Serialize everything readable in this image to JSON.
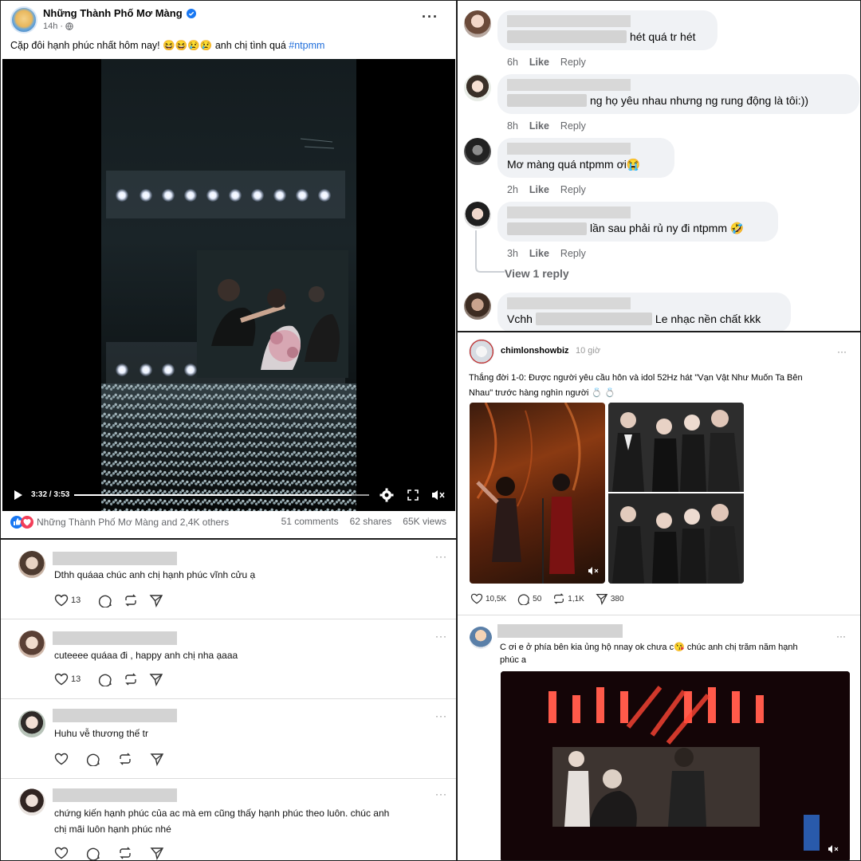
{
  "fb_post": {
    "page_name": "Những Thành Phố Mơ Màng",
    "time": "14h ·",
    "caption_text": "Cặp đôi hạnh phúc nhất hôm nay! 😆😆😢😢 anh chị tình quá ",
    "hashtag": "#ntpmm",
    "video_time": "3:32 / 3:53",
    "video_progress": 0.94,
    "reactions_text": "Những Thành Phố Mơ Màng and 2,4K others",
    "comments": "51 comments",
    "shares": "62 shares",
    "views": "65K views"
  },
  "fb_comments": [
    {
      "text": "hét quá tr hét",
      "time": "6h",
      "like": "Like",
      "reply": "Reply"
    },
    {
      "text": "ng họ yêu nhau nhưng ng rung động là tôi:))",
      "time": "8h",
      "like": "Like",
      "reply": "Reply"
    },
    {
      "text": "Mơ màng quá ntpmm ơi😭",
      "time": "2h",
      "like": "Like",
      "reply": "Reply"
    },
    {
      "text": "lần sau phải rủ ny đi ntpmm 🤣",
      "time": "3h",
      "like": "Like",
      "reply": "Reply"
    },
    {
      "text": "Vchh",
      "text2": "Le nhạc nền chất kkk"
    }
  ],
  "view_reply": "View 1 reply",
  "threads_left": [
    {
      "text": "Dthh quáaa chúc anh chị hạnh phúc vĩnh cửu ạ",
      "likes": "13"
    },
    {
      "text": "cuteeee quáaa đi , happy anh chị nha ạaaa",
      "likes": "13"
    },
    {
      "text": "Huhu vễ thương thế tr",
      "likes": ""
    },
    {
      "text_line1": "chứng kiến hạnh phúc của ac mà em cũng thấy hạnh phúc theo luôn. chúc anh",
      "text_line2": "chị mãi luôn hạnh phúc nhé",
      "likes": ""
    }
  ],
  "threads_right": {
    "user": "chimlonshowbiz",
    "time": "10 giờ",
    "text_line1": "Thắng đời 1-0: Được người yêu cầu hôn và idol 52Hz hát \"Vạn Vật Như Muốn Ta Bên",
    "text_line2": "Nhau\" trước hàng nghìn người 💍 💍",
    "likes": "10,5K",
    "comments": "50",
    "reposts": "1,1K",
    "shares": "380"
  },
  "threads_right2": {
    "text_line1": "C ơi e ở phía bên kia ủng hộ nnay ok chưa c😘  chúc anh chị trăm năm hạnh",
    "text_line2": "phúc a"
  },
  "dots": "···",
  "colors": {
    "fb_blue": "#216fdb",
    "bubble": "#f0f2f5",
    "muted": "#65676b"
  }
}
